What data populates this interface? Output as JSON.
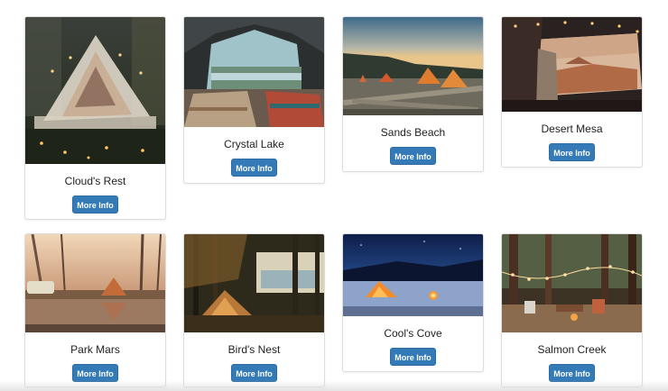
{
  "campgrounds": [
    {
      "name": "Cloud's Rest",
      "button": "More Info",
      "icon": "tent-canopy-night-photo"
    },
    {
      "name": "Crystal Lake",
      "button": "More Info",
      "icon": "tent-interior-lake-photo"
    },
    {
      "name": "Sands Beach",
      "button": "More Info",
      "icon": "beach-tents-sunset-photo"
    },
    {
      "name": "Desert Mesa",
      "button": "More Info",
      "icon": "car-window-desert-photo"
    },
    {
      "name": "Park Mars",
      "button": "More Info",
      "icon": "lakeside-camp-photo"
    },
    {
      "name": "Bird's Nest",
      "button": "More Info",
      "icon": "forest-tent-photo"
    },
    {
      "name": "Cool's Cove",
      "button": "More Info",
      "icon": "lit-tent-night-photo"
    },
    {
      "name": "Salmon Creek",
      "button": "More Info",
      "icon": "forest-campsite-lights-photo"
    }
  ],
  "colors": {
    "button_bg": "#337ab7",
    "button_text": "#ffffff",
    "card_border": "#dcdcdc"
  }
}
